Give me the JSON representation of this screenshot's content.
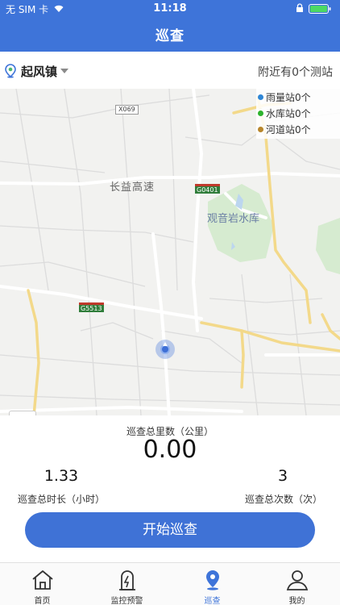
{
  "status_bar": {
    "carrier": "无 SIM 卡",
    "time": "11:18"
  },
  "nav": {
    "title": "巡查"
  },
  "location": {
    "town": "起风镇",
    "nearby": "附近有0个测站"
  },
  "map": {
    "legend": [
      {
        "label": "雨量站0个",
        "color": "#2f86d6"
      },
      {
        "label": "水库站0个",
        "color": "#2db32d"
      },
      {
        "label": "河道站0个",
        "color": "#b8862b"
      }
    ],
    "labels": {
      "expressway": "长益高速",
      "reservoir": "观音岩水库",
      "road_x069": "X069",
      "road_g0401": "G0401",
      "road_g5513": "G5513"
    }
  },
  "stats": {
    "distance_label": "巡查总里数（公里）",
    "distance_value": "0.00",
    "duration_value": "1.33",
    "duration_label": "巡查总时长（小时）",
    "count_value": "3",
    "count_label": "巡查总次数（次）"
  },
  "actions": {
    "start_label": "开始巡查"
  },
  "tabbar": {
    "home": "首页",
    "monitor": "监控预警",
    "patrol": "巡查",
    "mine": "我的",
    "active_color": "#3e74d9"
  }
}
